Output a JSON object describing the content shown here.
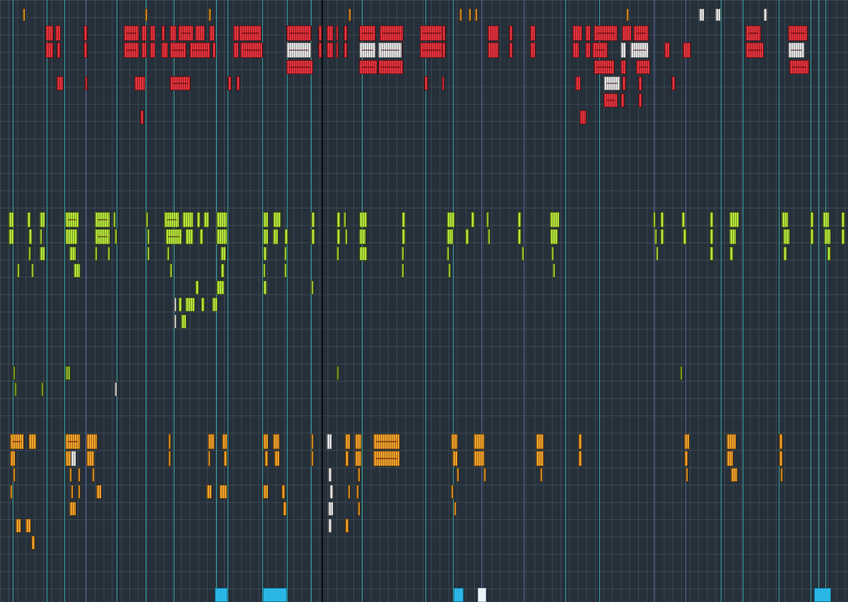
{
  "view": "arrangement-timeline",
  "colors": {
    "background": "#26303a",
    "grid_line": "#6e7d8c",
    "marker_primary": "#39c6c6",
    "marker_secondary": "#6a74c8",
    "playhead": "#0a0c10",
    "drums": "#e8323c",
    "drums_selected": "#e6e6e6",
    "synths": "#b6e63a",
    "synths_dim": "#8fb22a",
    "bass": "#f2a12a",
    "loop_block": "#2bb7e6"
  },
  "lanes": [
    {
      "id": "lane-top",
      "color": "#f2a12a"
    },
    {
      "id": "lane-drums",
      "color": "#e8323c"
    },
    {
      "id": "lane-synths",
      "color": "#b6e63a"
    },
    {
      "id": "lane-bass",
      "color": "#f2a12a"
    }
  ]
}
